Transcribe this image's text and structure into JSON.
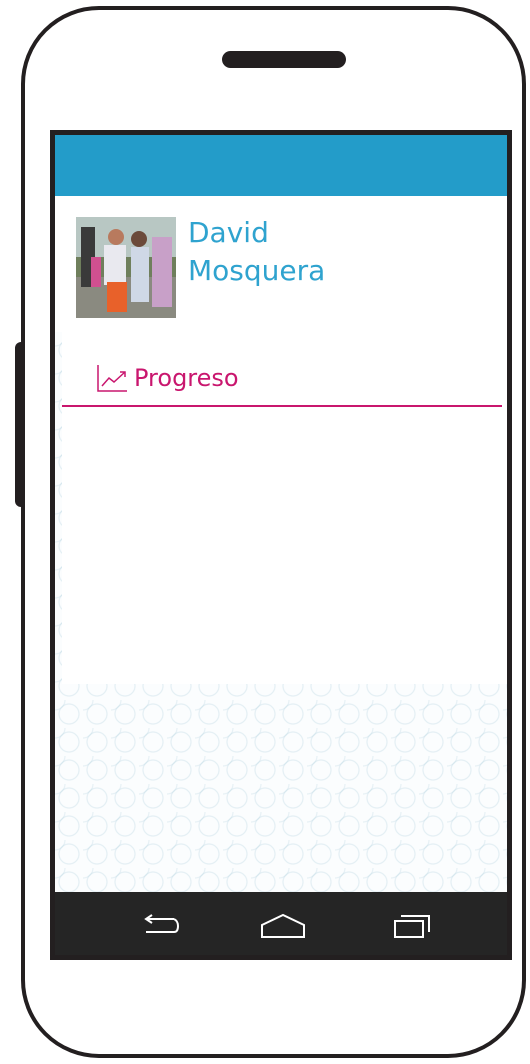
{
  "user": {
    "first_name": "David",
    "last_name": "Mosquera"
  },
  "section": {
    "title": "Progreso",
    "icon": "line-chart-icon"
  },
  "colors": {
    "topbar": "#239cc9",
    "name": "#2fa3cf",
    "accent": "#c9166e",
    "navbar": "#252525",
    "frame": "#231f20"
  },
  "navbar": {
    "icons": [
      "back-icon",
      "home-icon",
      "recent-apps-icon"
    ]
  }
}
